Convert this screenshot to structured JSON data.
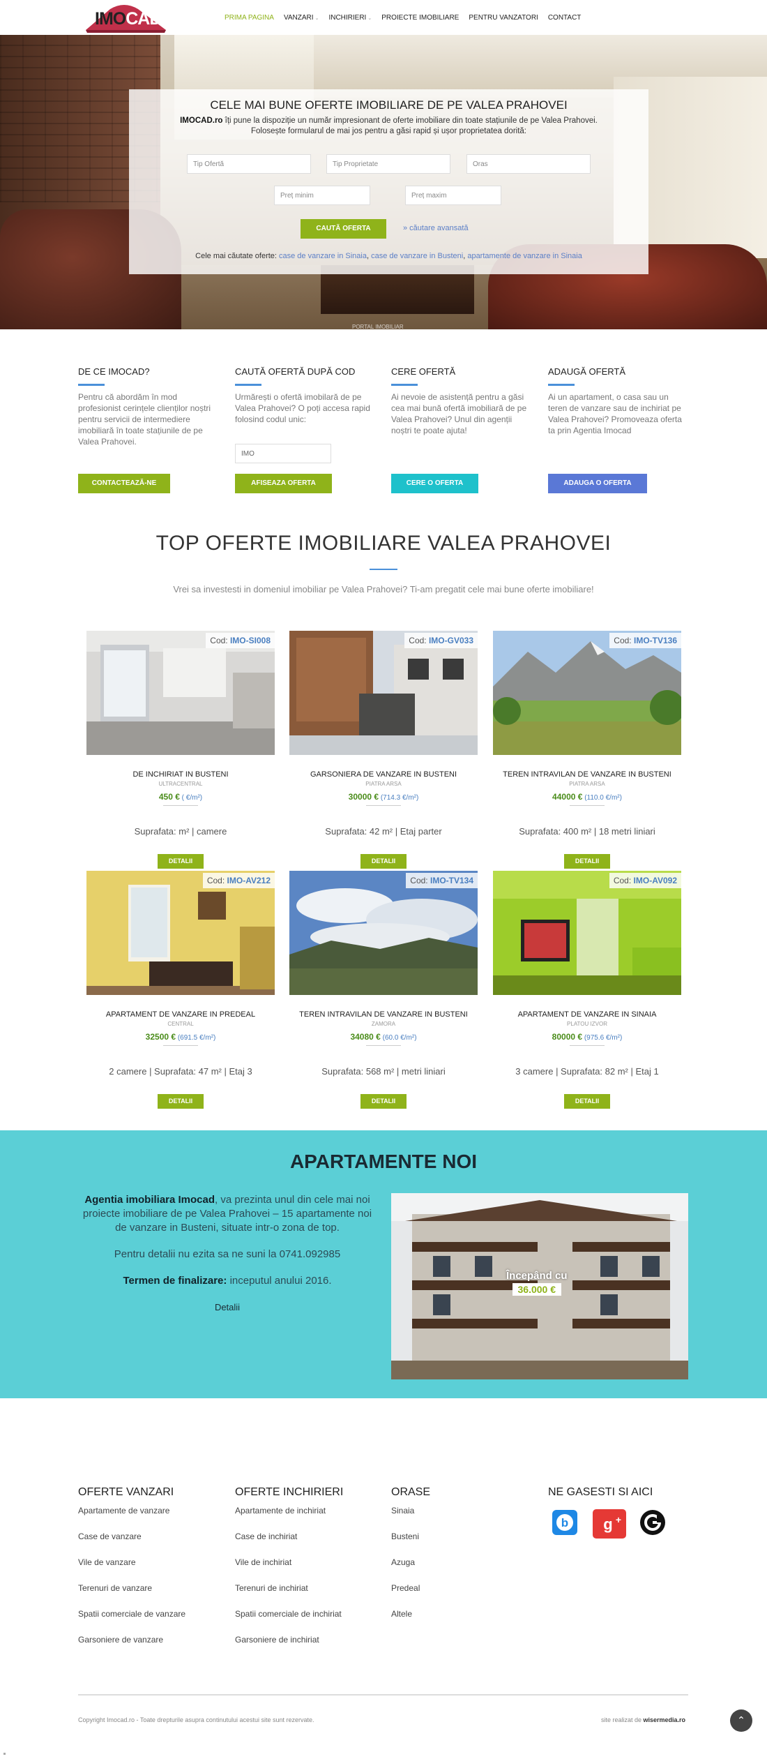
{
  "logo": {
    "part1": "IMO",
    "part2": "CAD"
  },
  "nav": [
    {
      "label": "PRIMA PAGINA",
      "active": true
    },
    {
      "label": "VANZARI",
      "dropdown": true
    },
    {
      "label": "INCHIRIERI",
      "dropdown": true
    },
    {
      "label": "PROIECTE IMOBILIARE"
    },
    {
      "label": "PENTRU VANZATORI"
    },
    {
      "label": "CONTACT"
    }
  ],
  "hero": {
    "title": "CELE MAI BUNE OFERTE IMOBILIARE DE PE VALEA PRAHOVEI",
    "brand": "IMOCAD.ro",
    "desc1": " îți pune la dispoziție un număr impresionant de oferte imobiliare din toate stațiunile de pe Valea Prahovei.",
    "desc2": "Folosește formularul de mai jos pentru a găsi rapid și ușor proprietatea dorită:",
    "inputs": {
      "tip_oferta": "Tip Ofertă",
      "tip_proprietate": "Tip Proprietate",
      "oras": "Oras",
      "pret_min": "Preț minim",
      "pret_max": "Preț maxim"
    },
    "button": "CAUTĂ OFERTA",
    "advanced": "» căutare avansată",
    "popular_label": "Cele mai căutate oferte: ",
    "popular": [
      "case de vanzare in Sinaia",
      "case de vanzare in Busteni",
      "apartamente de vanzare in Sinaia"
    ],
    "bottom_text": "PORTAL IMOBILIAR"
  },
  "info": [
    {
      "title": "DE CE IMOCAD?",
      "text": "Pentru că abordăm în mod profesionist cerințele clienților noștri pentru servicii de intermediere imobiliară în toate stațiunile de pe Valea Prahovei.",
      "button": "CONTACTEAZĂ-NE",
      "color": "#8fb31a"
    },
    {
      "title": "CAUTĂ OFERTĂ DUPĂ COD",
      "text": "Urmărești o ofertă imobilară de pe Valea Prahovei? O poți accesa rapid folosind codul unic:",
      "input": "IMO",
      "button": "AFISEAZA OFERTA",
      "color": "#8fb31a"
    },
    {
      "title": "CERE OFERTĂ",
      "text": "Ai nevoie de asistență pentru a găsi cea mai bună ofertă imobiliară de pe Valea Prahovei? Unul din agenții noștri te poate ajuta!",
      "button": "CERE O OFERTA",
      "color": "#1ec1cb"
    },
    {
      "title": "ADAUGĂ OFERTĂ",
      "text": "Ai un apartament, o casa sau un teren de vanzare sau de inchiriat pe Valea Prahovei? Promoveaza oferta ta prin Agentia Imocad",
      "button": "ADAUGA O OFERTA",
      "color": "#5a78d6"
    }
  ],
  "top": {
    "title": "TOP OFERTE IMOBILIARE VALEA PRAHOVEI",
    "subtitle": "Vrei sa investesti in domeniul imobiliar pe Valea Prahovei? Ti-am pregatit cele mai bune oferte imobiliare!"
  },
  "cards": [
    {
      "code_label": "Cod: ",
      "code": "IMO-SI008",
      "title": "DE INCHIRIAT IN BUSTENI",
      "zone": "ULTRACENTRAL",
      "price": "450 €",
      "per": " ( €/m²)",
      "details": "Suprafata: m² | camere",
      "button": "DETALII",
      "img": "office"
    },
    {
      "code_label": "Cod: ",
      "code": "IMO-GV033",
      "title": "GARSONIERA DE VANZARE IN BUSTENI",
      "zone": "PIATRA ARSA",
      "price": "30000 €",
      "per": " (714.3 €/m²)",
      "details": "Suprafata: 42 m² | Etaj parter",
      "button": "DETALII",
      "img": "building"
    },
    {
      "code_label": "Cod: ",
      "code": "IMO-TV136",
      "title": "TEREN INTRAVILAN DE VANZARE IN BUSTENI",
      "zone": "PIATRA ARSA",
      "price": "44000 €",
      "per": " (110.0 €/m²)",
      "details": "Suprafata: 400 m² | 18 metri liniari",
      "button": "DETALII",
      "img": "mountain"
    },
    {
      "code_label": "Cod: ",
      "code": "IMO-AV212",
      "title": "APARTAMENT DE VANZARE IN PREDEAL",
      "zone": "CENTRAL",
      "price": "32500 €",
      "per": " (691.5 €/m²)",
      "details": "2 camere | Suprafata: 47 m² | Etaj 3",
      "button": "DETALII",
      "img": "room"
    },
    {
      "code_label": "Cod: ",
      "code": "IMO-TV134",
      "title": "TEREN INTRAVILAN DE VANZARE IN BUSTENI",
      "zone": "ZAMORA",
      "price": "34080 €",
      "per": " (60.0 €/m²)",
      "details": "Suprafata: 568 m² | metri liniari",
      "button": "DETALII",
      "img": "sky"
    },
    {
      "code_label": "Cod: ",
      "code": "IMO-AV092",
      "title": "APARTAMENT DE VANZARE IN SINAIA",
      "zone": "PLATOU IZVOR",
      "price": "80000 €",
      "per": " (975.6 €/m²)",
      "details": "3 camere | Suprafata: 82 m² | Etaj 1",
      "button": "DETALII",
      "img": "green"
    }
  ],
  "newapt": {
    "title": "APARTAMENTE NOI",
    "brand": "Agentia imobiliara Imocad",
    "text1": ", va prezinta unul din cele mai noi proiecte imobiliare de pe Valea Prahovei – 15 apartamente noi de vanzare in Busteni, situate intr-o zona de top.",
    "text2": "Pentru detalii nu ezita sa ne suni la 0741.092985",
    "deadline_label": "Termen de finalizare:",
    "deadline": " inceputul anului 2016.",
    "link": "Detalii",
    "price_label": "Începând cu",
    "price": "36.000 €"
  },
  "footer": {
    "cols": [
      {
        "title": "OFERTE VANZARI",
        "items": [
          "Apartamente de vanzare",
          "Case de vanzare",
          "Vile de vanzare",
          "Terenuri de vanzare",
          "Spatii comerciale de vanzare",
          "Garsoniere de vanzare"
        ]
      },
      {
        "title": "OFERTE INCHIRIERI",
        "items": [
          "Apartamente de inchiriat",
          "Case de inchiriat",
          "Vile de inchiriat",
          "Terenuri de inchiriat",
          "Spatii comerciale de inchiriat",
          "Garsoniere de inchiriat"
        ]
      },
      {
        "title": "ORASE",
        "items": [
          "Sinaia",
          "Busteni",
          "Azuga",
          "Predeal",
          "Altele"
        ]
      },
      {
        "title": "NE GASESTI SI AICI",
        "items": []
      }
    ],
    "copyright": "Copyright Imocad.ro - Toate drepturile asupra continutului acestui site sunt rezervate.",
    "credit_label": "site realizat de ",
    "credit": "wisermedia.ro",
    "scroll_icon": "chevron-up-icon"
  }
}
